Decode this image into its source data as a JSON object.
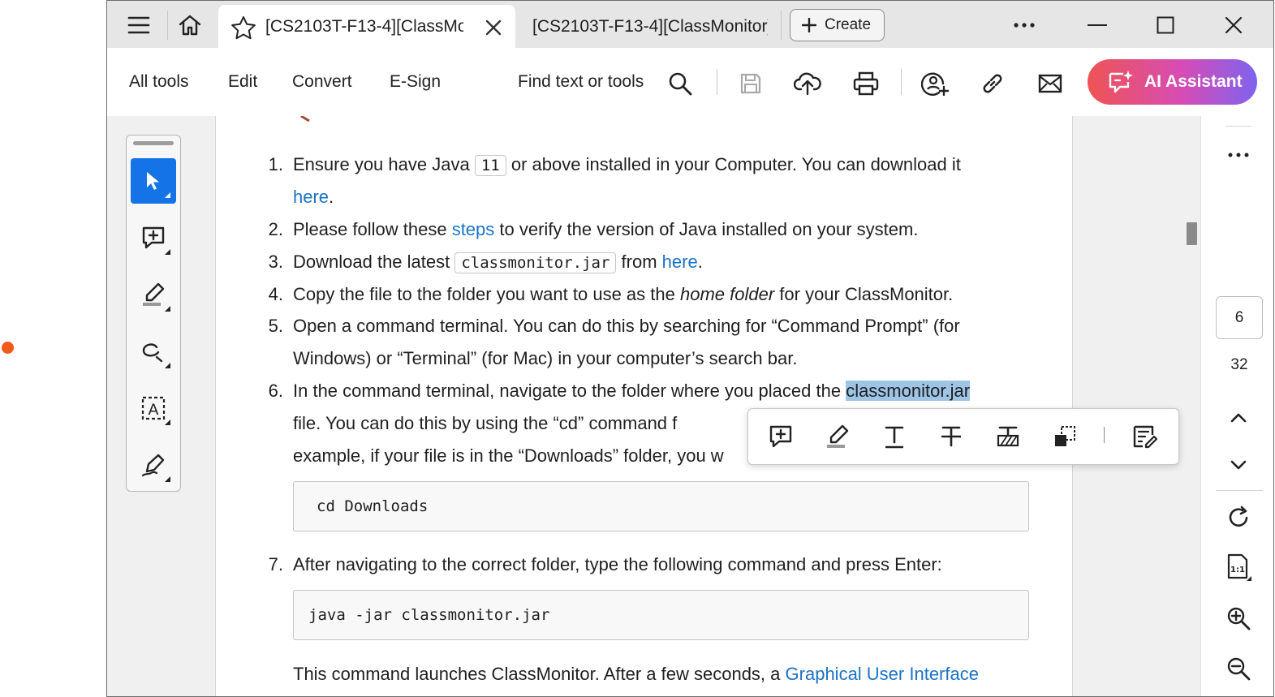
{
  "tabs": [
    {
      "title": "[CS2103T-F13-4][ClassMonitor]",
      "active": true
    },
    {
      "title": "[CS2103T-F13-4][ClassMonitor]",
      "active": false
    }
  ],
  "tabbar": {
    "create_label": "Create"
  },
  "menu": {
    "all_tools": "All tools",
    "edit": "Edit",
    "convert": "Convert",
    "esign": "E-Sign",
    "find": "Find text or tools"
  },
  "ai": {
    "label": "AI Assistant"
  },
  "doc": {
    "n1": "1.",
    "s1_a": "Ensure you have Java",
    "s1_code": "11",
    "s1_b": "or above installed in your Computer. You can download it",
    "s1_link": "here",
    "s1_end": ".",
    "n2": "2.",
    "s2_a": "Please follow these",
    "s2_link": "steps",
    "s2_b": "to verify the version of Java installed on your system.",
    "n3": "3.",
    "s3_a": "Download the latest",
    "s3_code": "classmonitor.jar",
    "s3_b": "from",
    "s3_link": "here",
    "s3_end": ".",
    "n4": "4.",
    "s4_a": "Copy the file to the folder you want to use as the",
    "s4_em": "home folder",
    "s4_b": "for your ClassMonitor.",
    "n5": "5.",
    "s5_l1": "Open a command terminal. You can do this by searching for “Command Prompt” (for",
    "s5_l2": "Windows) or “Terminal” (for Mac) in your computer’s search bar.",
    "n6": "6.",
    "s6_l1": "In the command terminal, navigate to the folder where you placed the",
    "s6_hl": "classmonitor.jar",
    "s6_l2": "file. You can do this by using the “cd” command f",
    "s6_l3": "example, if your file is in the “Downloads” folder, you w",
    "code1": "cd Downloads",
    "n7": "7.",
    "s7": "After navigating to the correct folder, type the following command and press Enter:",
    "code2": "java -jar classmonitor.jar",
    "s8_a": "This command launches ClassMonitor. After a few seconds, a",
    "s8_link": "Graphical User Interface"
  },
  "pager": {
    "current": "6",
    "total": "32"
  },
  "colors": {
    "accent": "#1473e6",
    "link": "#1a73c8",
    "highlight": "#9ec4e6",
    "status_dot": "#f25a1b"
  }
}
